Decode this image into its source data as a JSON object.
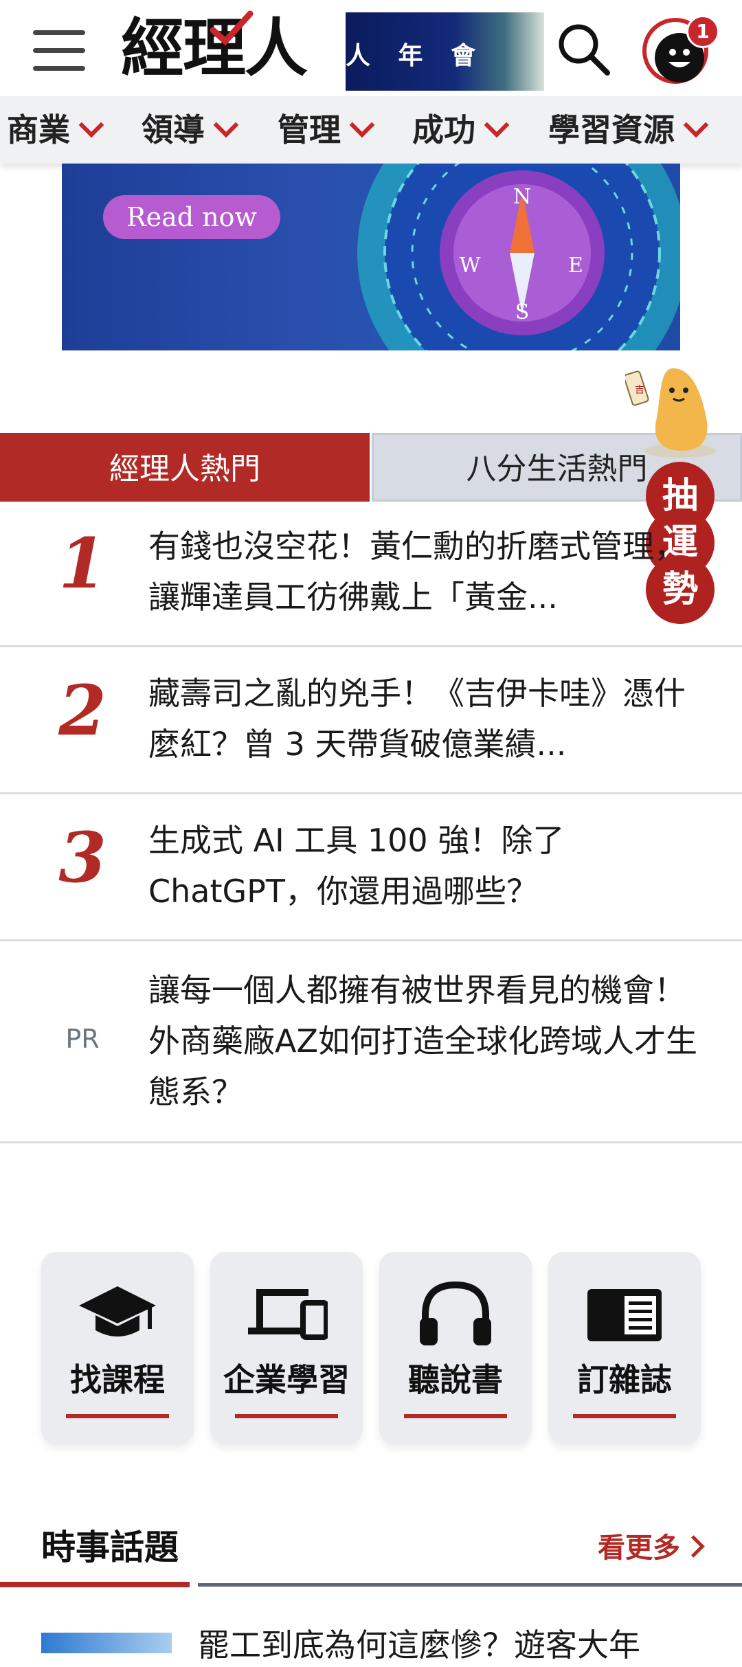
{
  "header": {
    "logo_text": "經理人",
    "ad_text": "人 年 會",
    "notification_count": "1"
  },
  "category_nav": [
    {
      "label": "商業"
    },
    {
      "label": "領導"
    },
    {
      "label": "管理"
    },
    {
      "label": "成功"
    },
    {
      "label": "學習資源"
    }
  ],
  "promo": {
    "button_label": "Read now",
    "compass_letters": [
      "N",
      "W",
      "E",
      "S"
    ]
  },
  "fortune": {
    "chars": [
      "抽",
      "運",
      "勢"
    ],
    "stick_char": "吉"
  },
  "tabs": [
    {
      "label": "經理人熱門",
      "active": true
    },
    {
      "label": "八分生活熱門",
      "active": false
    }
  ],
  "ranked_list": [
    {
      "rank": "1",
      "title": "有錢也沒空花！黃仁勳的折磨式管理，讓輝達員工彷彿戴上「黃金..."
    },
    {
      "rank": "2",
      "title": "藏壽司之亂的兇手！《吉伊卡哇》憑什麼紅？曾 3 天帶貨破億業績..."
    },
    {
      "rank": "3",
      "title": "生成式 AI 工具 100 強！除了 ChatGPT，你還用過哪些？"
    },
    {
      "rank": "PR",
      "title": "讓每一個人都擁有被世界看見的機會！外商藥廠AZ如何打造全球化跨域人才生態系？"
    }
  ],
  "quick_links": [
    {
      "label": "找課程",
      "icon": "graduation-cap-icon"
    },
    {
      "label": "企業學習",
      "icon": "devices-icon"
    },
    {
      "label": "聽說書",
      "icon": "headphones-icon"
    },
    {
      "label": "訂雜誌",
      "icon": "magazine-icon"
    }
  ],
  "news": {
    "section_title": "時事話題",
    "more_label": "看更多",
    "first_headline": "罷工到底為何這麼慘？遊客大年"
  },
  "colors": {
    "brand_red": "#b22a25",
    "nav_bg": "#f0f1f3",
    "inactive_tab_bg": "#d6dbe4"
  }
}
